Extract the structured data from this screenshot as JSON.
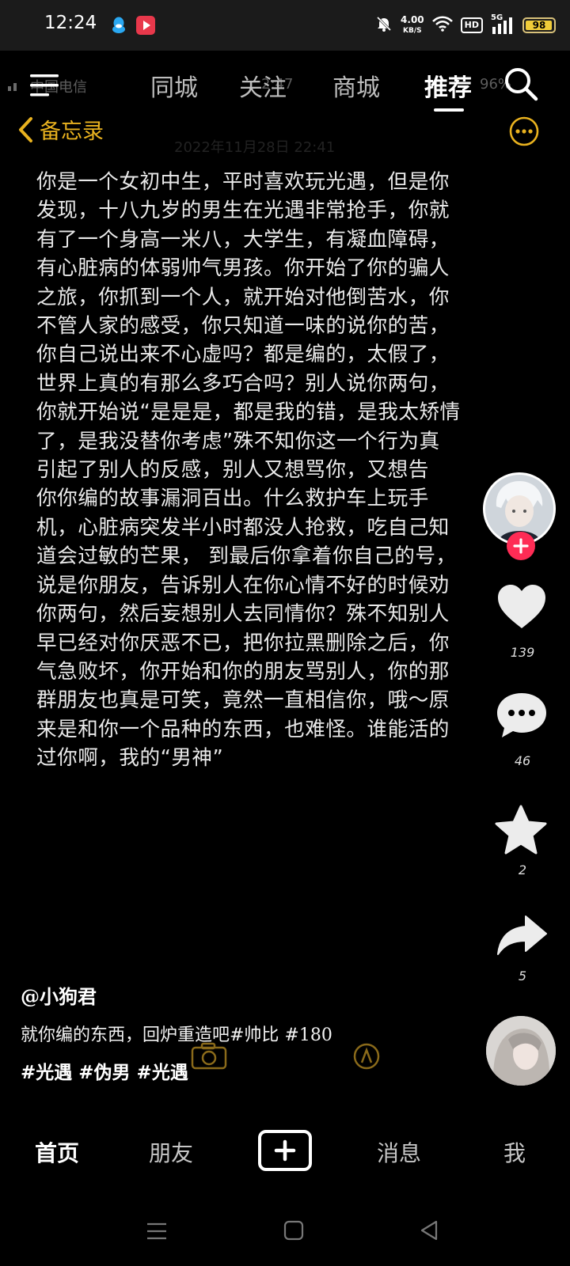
{
  "status_bar": {
    "time": "12:24",
    "net_speed_value": "4.00",
    "net_speed_unit": "KB/S",
    "hd_label": "HD",
    "network_type": "5G",
    "battery_level": "98",
    "battery_fraction": 0.98,
    "icons": [
      "qq-icon",
      "video-app-icon",
      "mute-bell-icon",
      "wifi-icon",
      "signal-icon",
      "battery-icon"
    ]
  },
  "ghost_status": {
    "carrier": "中国电信",
    "time_fragment": "2:47",
    "battery_fragment": "96%"
  },
  "top_nav": {
    "tabs": [
      "同城",
      "关注",
      "商城",
      "推荐"
    ],
    "active_tab": "推荐"
  },
  "memo": {
    "back_label": "备忘录",
    "date_faint": "2022年11月28日 22:41",
    "body": "你是一个女初中生，平时喜欢玩光遇，但是你\n发现，十八九岁的男生在光遇非常抢手，你就\n有了一个身高一米八，大学生，有凝血障碍，\n有心脏病的体弱帅气男孩。你开始了你的骗人\n之旅，你抓到一个人，就开始对他倒苦水，你\n不管人家的感受，你只知道一味的说你的苦，\n你自己说出来不心虚吗？都是编的，太假了，\n世界上真的有那么多巧合吗？别人说你两句，\n你就开始说“是是是，都是我的错，是我太矫情\n了，是我没替你考虑”殊不知你这一个行为真\n引起了别人的反感，别人又想骂你，又想告\n你你编的故事漏洞百出。什么救护车上玩手\n机，心脏病突发半小时都没人抢救，吃自己知\n道会过敏的芒果， 到最后你拿着你自己的号，\n说是你朋友，告诉别人在你心情不好的时候劝\n你两句，然后妄想别人去同情你？殊不知别人\n早已经对你厌恶不已，把你拉黑删除之后，你\n气急败坏，你开始和你的朋友骂别人，你的那\n群朋友也真是可笑，竟然一直相信你，哦～原\n来是和你一个品种的东西，也难怪。谁能活的\n过你啊，我的“男神”"
  },
  "actions": {
    "like_count": "139",
    "comment_count": "46",
    "favorite_count": "2",
    "share_count": "5"
  },
  "post": {
    "author": "@小狗君",
    "caption_line1": "就你编的东西，回炉重造吧#帅比 #180",
    "caption_line2": "#光遇 #伪男 #光遇"
  },
  "bottom_nav": {
    "home": "首页",
    "friends": "朋友",
    "messages": "消息",
    "me": "我"
  },
  "colors": {
    "accent_gold": "#e9b21f",
    "follow_red": "#fe2c55",
    "battery_yellow": "#f0cc39"
  }
}
